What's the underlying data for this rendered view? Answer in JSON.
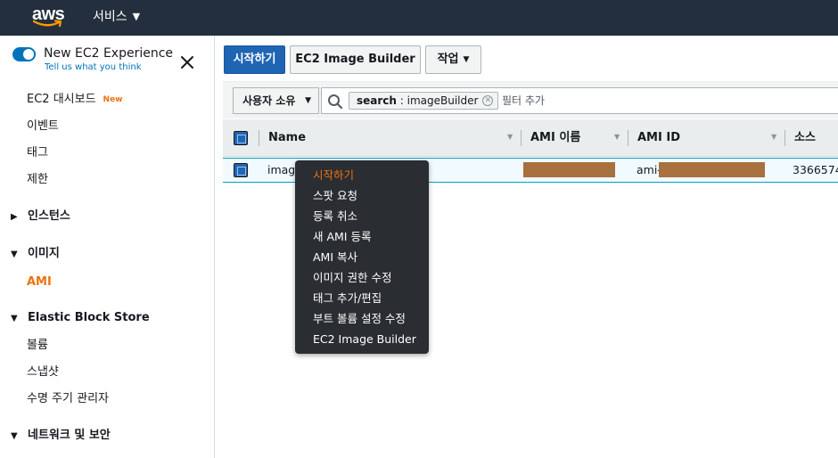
{
  "topnav": {
    "logo_text": "aws",
    "services_label": "서비스"
  },
  "sidebar": {
    "experience_title": "New EC2 Experience",
    "experience_link": "Tell us what you think",
    "items": [
      {
        "label": "EC2 대시보드",
        "badge": "New"
      },
      {
        "label": "이벤트"
      },
      {
        "label": "태그"
      },
      {
        "label": "제한"
      }
    ],
    "sections": [
      {
        "label": "인스턴스",
        "expanded": false
      },
      {
        "label": "이미지",
        "expanded": true,
        "children": [
          {
            "label": "AMI",
            "active": true
          }
        ]
      },
      {
        "label": "Elastic Block Store",
        "expanded": true,
        "children": [
          {
            "label": "볼륨"
          },
          {
            "label": "스냅샷"
          },
          {
            "label": "수명 주기 관리자"
          }
        ]
      },
      {
        "label": "네트워크 및 보안",
        "expanded": true
      }
    ]
  },
  "toolbar": {
    "launch_label": "시작하기",
    "builder_label": "EC2 Image Builder",
    "actions_label": "작업"
  },
  "filter": {
    "owner_label": "사용자 소유",
    "token_key": "search",
    "token_value": "imageBuilder",
    "placeholder": "필터 추가"
  },
  "table": {
    "columns": [
      "Name",
      "AMI 이름",
      "AMI ID",
      "소스"
    ],
    "rows": [
      {
        "name": "image",
        "ami_name": "",
        "ami_id": "ami-",
        "source": "3366574"
      }
    ]
  },
  "context_menu": {
    "items": [
      "시작하기",
      "스팟 요청",
      "등록 취소",
      "새 AMI 등록",
      "AMI 복사",
      "이미지 권한 수정",
      "태그 추가/편집",
      "부트 볼륨 설정 수정",
      "EC2 Image Builder"
    ],
    "highlighted_index": 0
  },
  "colors": {
    "nav_bg": "#232f3e",
    "primary": "#1f65b4",
    "accent": "#ec7211",
    "link": "#0073bb"
  }
}
